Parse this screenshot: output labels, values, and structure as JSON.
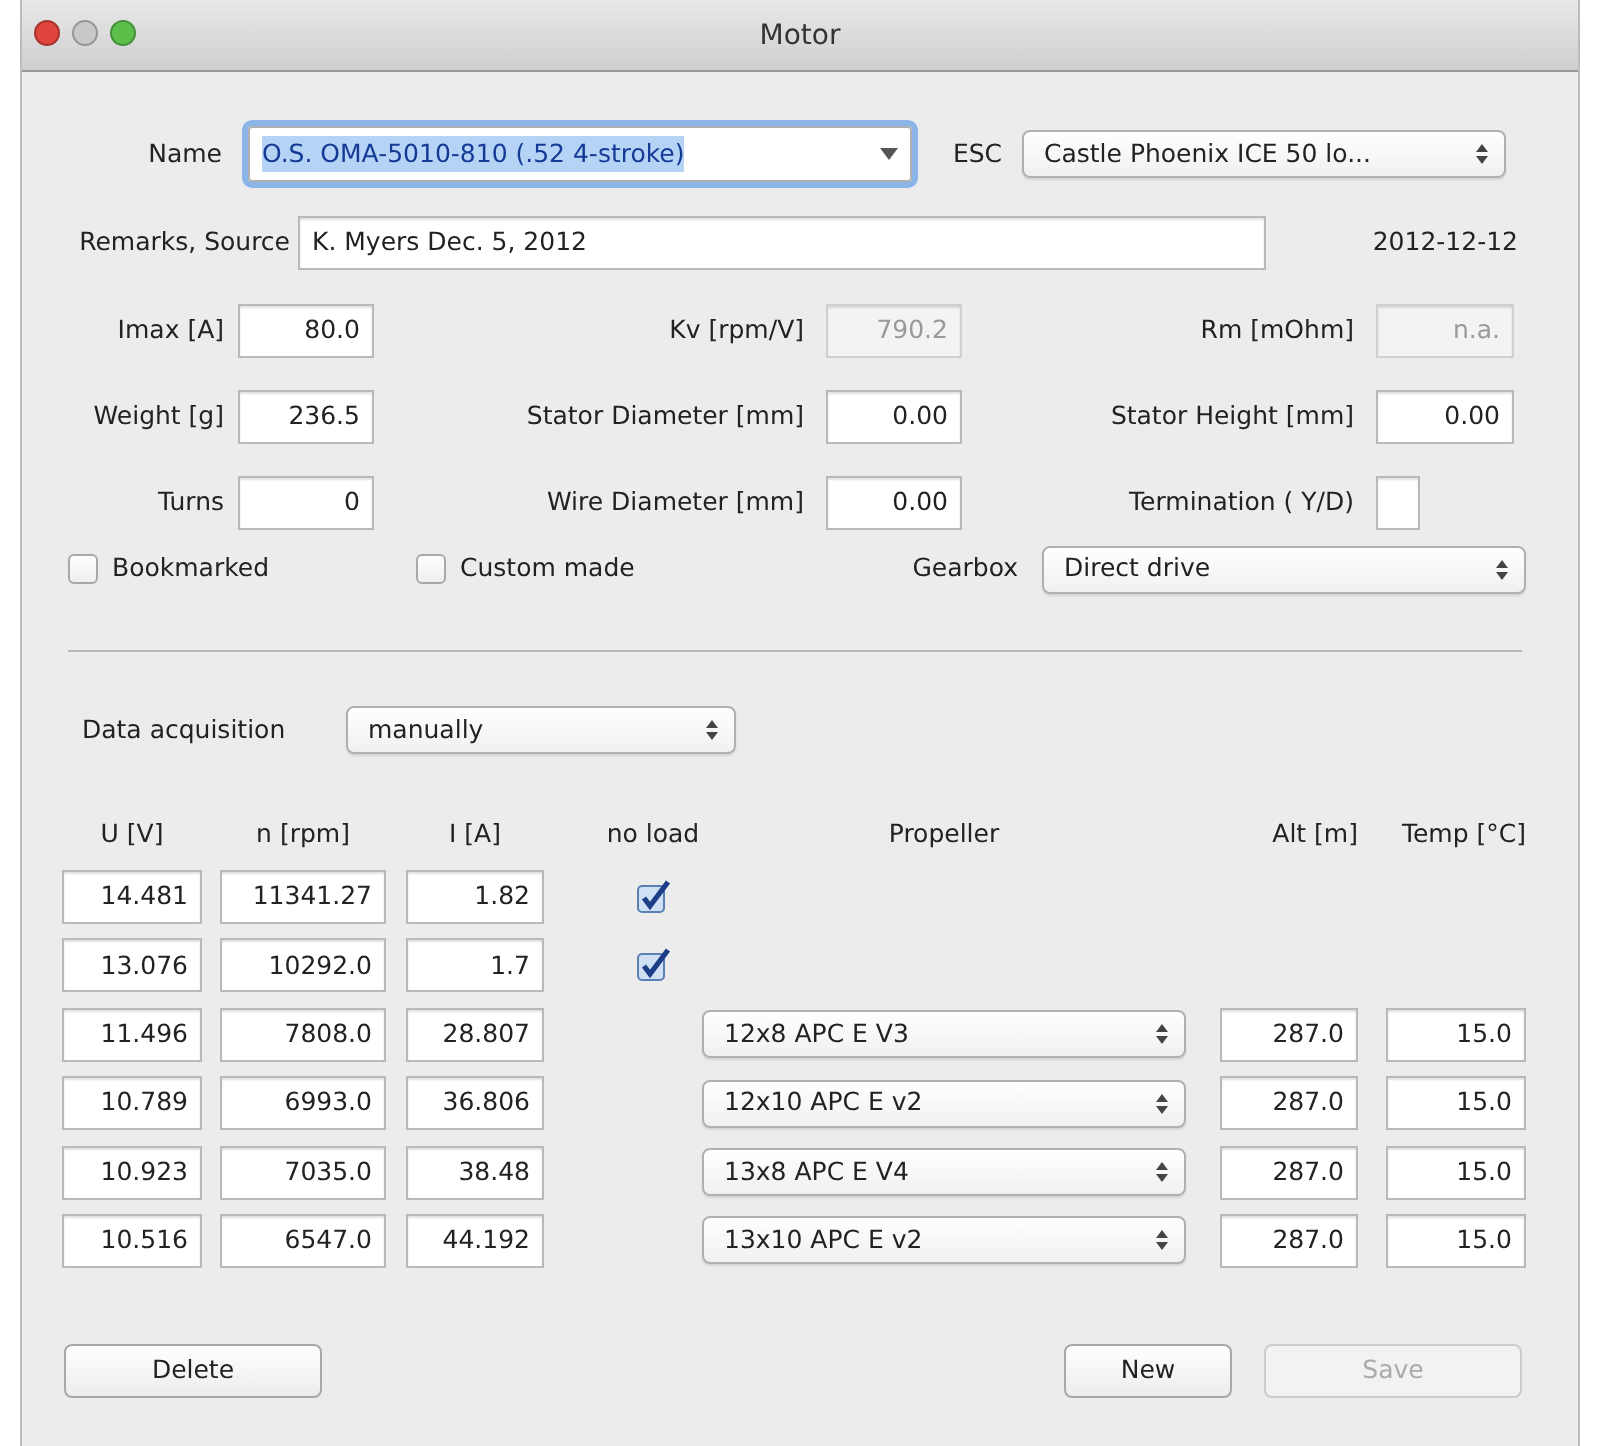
{
  "window": {
    "title": "Motor"
  },
  "name": {
    "label": "Name",
    "value": "O.S. OMA-5010-810 (.52 4-stroke)"
  },
  "esc": {
    "label": "ESC",
    "value": "Castle Phoenix ICE 50 lo..."
  },
  "remarks": {
    "label": "Remarks, Source",
    "value": "K. Myers Dec. 5, 2012"
  },
  "date": "2012-12-12",
  "fields": [
    {
      "label": "Imax [A]",
      "value": "80.0",
      "disabled": false
    },
    {
      "label": "Kv [rpm/V]",
      "value": "790.2",
      "disabled": true
    },
    {
      "label": "Rm [mOhm]",
      "value": "n.a.",
      "disabled": true
    },
    {
      "label": "Weight [g]",
      "value": "236.5",
      "disabled": false
    },
    {
      "label": "Stator Diameter [mm]",
      "value": "0.00",
      "disabled": false
    },
    {
      "label": "Stator Height [mm]",
      "value": "0.00",
      "disabled": false
    },
    {
      "label": "Turns",
      "value": "0",
      "disabled": false
    },
    {
      "label": "Wire Diameter [mm]",
      "value": "0.00",
      "disabled": false
    },
    {
      "label": "Termination ( Y/D)",
      "disabled": false
    }
  ],
  "checkboxes": [
    {
      "label": "Bookmarked",
      "checked": false
    },
    {
      "label": "Custom made",
      "checked": false
    }
  ],
  "gearbox": {
    "label": "Gearbox",
    "value": "Direct drive"
  },
  "data_acquisition": {
    "label": "Data acquisition",
    "value": "manually"
  },
  "table": {
    "columns": [
      "U [V]",
      "n [rpm]",
      "I [A]",
      "no load",
      "Propeller",
      "Alt [m]",
      "Temp [°C]"
    ],
    "rows": [
      {
        "u": "14.481",
        "n": "11341.27",
        "i": "1.82",
        "no_load": true
      },
      {
        "u": "13.076",
        "n": "10292.0",
        "i": "1.7",
        "no_load": true
      },
      {
        "u": "11.496",
        "n": "7808.0",
        "i": "28.807",
        "no_load": false,
        "propeller": "12x8 APC E V3",
        "alt": "287.0",
        "temp": "15.0"
      },
      {
        "u": "10.789",
        "n": "6993.0",
        "i": "36.806",
        "no_load": false,
        "propeller": "12x10 APC E v2",
        "alt": "287.0",
        "temp": "15.0"
      },
      {
        "u": "10.923",
        "n": "7035.0",
        "i": "38.48",
        "no_load": false,
        "propeller": "13x8 APC E V4",
        "alt": "287.0",
        "temp": "15.0"
      },
      {
        "u": "10.516",
        "n": "6547.0",
        "i": "44.192",
        "no_load": false,
        "propeller": "13x10 APC E v2",
        "alt": "287.0",
        "temp": "15.0"
      }
    ]
  },
  "buttons": [
    {
      "label": "Delete",
      "disabled": false
    },
    {
      "label": "New",
      "disabled": false
    },
    {
      "label": "Save",
      "disabled": true
    }
  ]
}
